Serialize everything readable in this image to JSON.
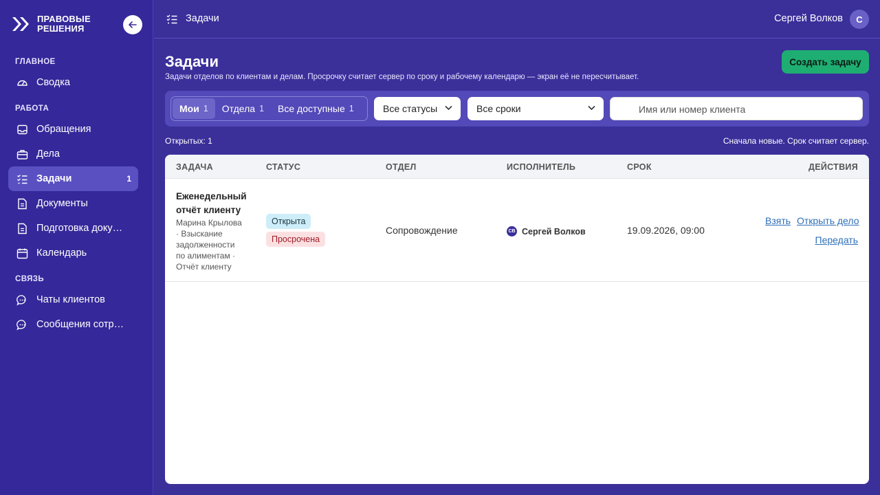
{
  "brand": {
    "line1": "ПРАВОВЫЕ",
    "line2": "РЕШЕНИЯ"
  },
  "sidebar": {
    "sections": {
      "main": "ГЛАВНОЕ",
      "work": "РАБОТА",
      "comm": "СВЯЗЬ"
    },
    "items": [
      {
        "label": "Сводка",
        "icon": "gauge-icon"
      },
      {
        "label": "Обращения",
        "icon": "inbox-icon"
      },
      {
        "label": "Дела",
        "icon": "briefcase-icon"
      },
      {
        "label": "Задачи",
        "icon": "tasks-icon",
        "badge": "1",
        "active": true
      },
      {
        "label": "Документы",
        "icon": "document-icon"
      },
      {
        "label": "Подготовка доку…",
        "icon": "document-prep-icon"
      },
      {
        "label": "Календарь",
        "icon": "calendar-icon"
      },
      {
        "label": "Чаты клиентов",
        "icon": "chat-icon"
      },
      {
        "label": "Сообщения сотр…",
        "icon": "chat-icon"
      }
    ]
  },
  "header": {
    "title": "Задачи",
    "user_name": "Сергей Волков",
    "user_initial": "С"
  },
  "page": {
    "title": "Задачи",
    "subtitle": "Задачи отделов по клиентам и делам. Просрочку считает сервер по сроку и рабочему календарю — экран её не пересчитывает.",
    "create_button": "Создать задачу"
  },
  "filters": {
    "scope": [
      {
        "label": "Мои",
        "count": "1",
        "active": true
      },
      {
        "label": "Отдела",
        "count": "1"
      },
      {
        "label": "Все доступные",
        "count": "1"
      }
    ],
    "status_select": "Все статусы",
    "deadline_select": "Все сроки",
    "search_placeholder": "Имя или номер клиента"
  },
  "summary": {
    "open_count": "Открытых: 1",
    "sort_note": "Сначала новые. Срок считает сервер."
  },
  "table": {
    "columns": [
      "ЗАДАЧА",
      "СТАТУС",
      "ОТДЕЛ",
      "ИСПОЛНИТЕЛЬ",
      "СРОК",
      "ДЕЙСТВИЯ"
    ],
    "rows": [
      {
        "title": "Еженедельный отчёт клиенту",
        "meta": "Марина Крылова · Взыскание задолженности по алиментам · Отчёт клиенту",
        "status": [
          "Открыта",
          "Просрочена"
        ],
        "department": "Сопровождение",
        "assignee_initials": "СВ",
        "assignee": "Сергей Волков",
        "deadline": "19.09.2026, 09:00",
        "actions": [
          "Взять",
          "Открыть дело",
          "Передать"
        ]
      }
    ]
  },
  "colors": {
    "background": "#3b2f9a",
    "accent": "#1fae72",
    "link": "#2f6fb7"
  }
}
